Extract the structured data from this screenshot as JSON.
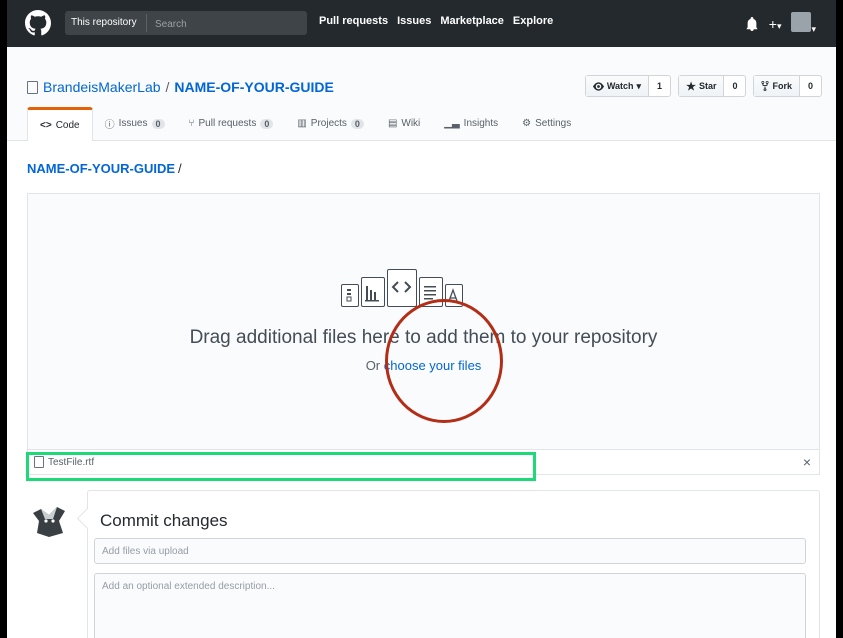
{
  "header": {
    "search_scope": "This repository",
    "search_placeholder": "Search",
    "nav": [
      "Pull requests",
      "Issues",
      "Marketplace",
      "Explore"
    ],
    "icons": [
      "github-logo-icon",
      "bell-icon",
      "plus-icon",
      "avatar"
    ]
  },
  "repo": {
    "owner": "BrandeisMakerLab",
    "separator": "/",
    "name": "NAME-OF-YOUR-GUIDE",
    "watch_label": "Watch",
    "watch_count": "1",
    "star_label": "Star",
    "star_count": "0",
    "fork_label": "Fork",
    "fork_count": "0"
  },
  "tabs": [
    {
      "label": "Code",
      "icon": "code-icon",
      "active": true
    },
    {
      "label": "Issues",
      "icon": "issue-icon",
      "count": "0"
    },
    {
      "label": "Pull requests",
      "icon": "pull-request-icon",
      "count": "0"
    },
    {
      "label": "Projects",
      "icon": "project-icon",
      "count": "0"
    },
    {
      "label": "Wiki",
      "icon": "wiki-icon"
    },
    {
      "label": "Insights",
      "icon": "graph-icon"
    },
    {
      "label": "Settings",
      "icon": "gear-icon"
    }
  ],
  "breadcrumb": {
    "repo": "NAME-OF-YOUR-GUIDE",
    "separator": "/"
  },
  "upload": {
    "drop_text": "Drag additional files here to add them to your repository",
    "choose_prefix": "Or ",
    "choose_link": "choose your files"
  },
  "file": {
    "name": "TestFile.rtf",
    "remove": "×"
  },
  "commit": {
    "title": "Commit changes",
    "summary_placeholder": "Add files via upload",
    "description_placeholder": "Add an optional extended description..."
  },
  "colors": {
    "header_bg": "#24292e",
    "link": "#0366d6",
    "annotation_circle": "#b32e17",
    "annotation_rect": "#1ed978",
    "active_tab_accent": "#e36209"
  }
}
